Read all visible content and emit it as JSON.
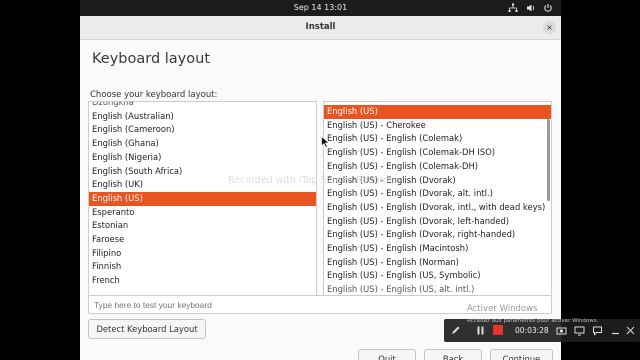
{
  "topbar": {
    "clock": "Sep 14  13:01",
    "icons": [
      "network-icon",
      "speaker-icon",
      "power-icon"
    ]
  },
  "window": {
    "title": "Install",
    "close_glyph": "×"
  },
  "page": {
    "title": "Keyboard layout",
    "choose_label": "Choose your keyboard layout:"
  },
  "layout_list": {
    "items": [
      "Dzongkha",
      "English (Australian)",
      "English (Cameroon)",
      "English (Ghana)",
      "English (Nigeria)",
      "English (South Africa)",
      "English (UK)",
      "English (US)",
      "Esperanto",
      "Estonian",
      "Faroese",
      "Filipino",
      "Finnish",
      "French"
    ],
    "selected": "English (US)"
  },
  "variant_list": {
    "items": [
      "English (US)",
      "English (US) - Cherokee",
      "English (US) - English (Colemak)",
      "English (US) - English (Colemak-DH ISO)",
      "English (US) - English (Colemak-DH)",
      "English (US) - English (Dvorak)",
      "English (US) - English (Dvorak, alt. intl.)",
      "English (US) - English (Dvorak, intl., with dead keys)",
      "English (US) - English (Dvorak, left-handed)",
      "English (US) - English (Dvorak, right-handed)",
      "English (US) - English (Macintosh)",
      "English (US) - English (Norman)",
      "English (US) - English (US, Symbolic)",
      "English (US) - English (US, alt. intl.)"
    ],
    "selected": "English (US)"
  },
  "test_input": {
    "placeholder": "Type here to test your keyboard"
  },
  "buttons": {
    "detect": "Detect Keyboard Layout",
    "quit": "Quit",
    "back": "Back",
    "continue": "Continue"
  },
  "overlays": {
    "recorded_watermark": "Recorded with iTop Screen Recorder",
    "activate_windows": "Activer Windows",
    "activate_hint": "Accédez aux paramètres pour activer Windows.",
    "rec_time": "00:03:28"
  },
  "colors": {
    "accent": "#e95420",
    "topbar": "#1c1c1c",
    "window_bg": "#fafafa"
  }
}
